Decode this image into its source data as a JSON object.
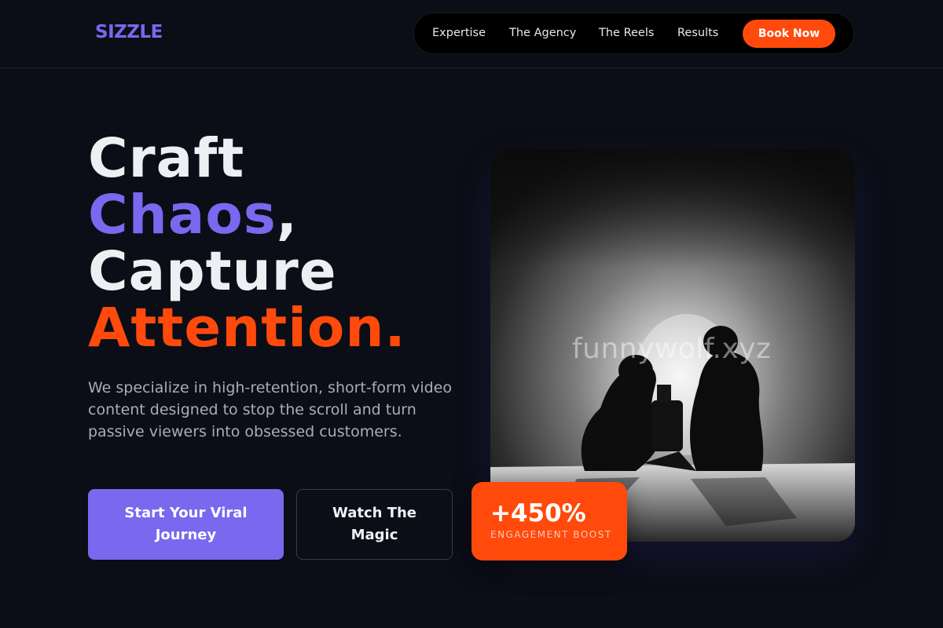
{
  "header": {
    "logo": "SIZZLE",
    "nav": [
      {
        "label": "Expertise"
      },
      {
        "label": "The Agency"
      },
      {
        "label": "The Reels"
      },
      {
        "label": "Results"
      }
    ],
    "cta_label": "Book Now"
  },
  "hero": {
    "headline": {
      "line1": "Craft",
      "line2_accent": "Chaos",
      "line2_rest": ",",
      "line3": "Capture",
      "line4_accent": "Attention."
    },
    "description": "We specialize in high-retention, short-form video content designed to stop the scroll and turn passive viewers into obsessed customers.",
    "primary_button": "Start Your Viral Journey",
    "secondary_button": "Watch The Magic",
    "image_watermark": "funnywolf.xyz",
    "stat": {
      "value": "+450%",
      "label": "ENGAGEMENT BOOST"
    }
  },
  "colors": {
    "background": "#0b0e16",
    "accent_purple": "#7a68ee",
    "accent_orange": "#ff4a0c",
    "text_primary": "#eeeff2",
    "text_muted": "#a9adb6"
  },
  "icons": {
    "hero_image": "film-crew-photo"
  }
}
